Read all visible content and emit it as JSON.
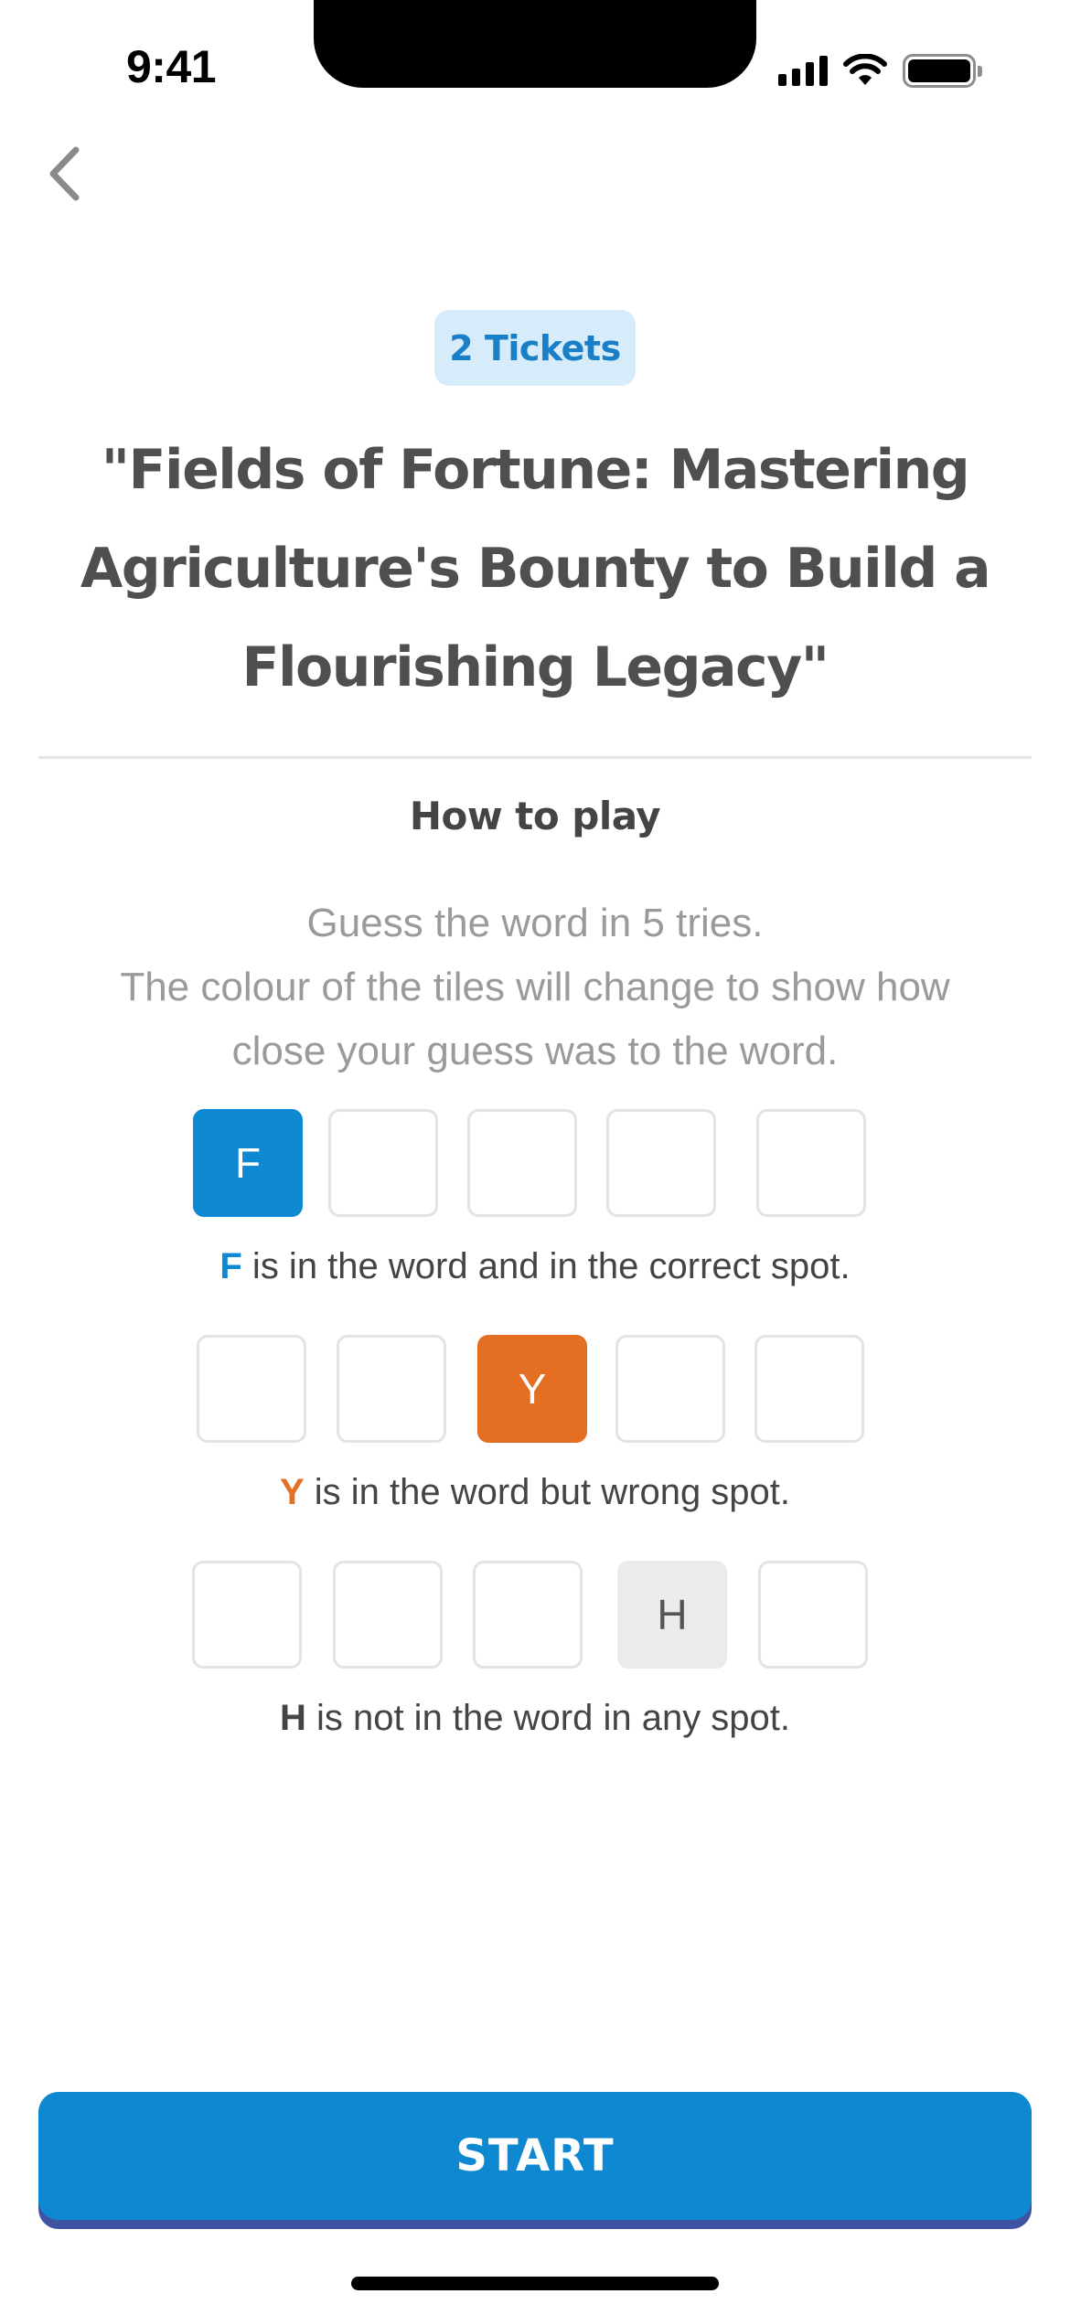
{
  "status_bar": {
    "time": "9:41",
    "icons": [
      "cellular-signal-icon",
      "wifi-icon",
      "battery-icon"
    ]
  },
  "header": {
    "back_icon": "chevron-left-icon",
    "tickets": "2 Tickets",
    "title_lines": [
      "\"Fields of Fortune: Mastering",
      "Agriculture's Bounty to Build a",
      "Flourishing Legacy\""
    ]
  },
  "how_to_play": {
    "heading": "How to play",
    "lines": [
      "Guess the word in 5 tries.",
      "The colour of the tiles will change to show how",
      "close your guess was to the word."
    ],
    "examples": [
      {
        "tiles": [
          "F",
          "",
          "",
          "",
          ""
        ],
        "highlight_index": 0,
        "state": "correct",
        "letter": "F",
        "caption": " is in the word and in the correct spot."
      },
      {
        "tiles": [
          "",
          "",
          "Y",
          "",
          ""
        ],
        "highlight_index": 2,
        "state": "present",
        "letter": "Y",
        "caption": " is in the word but wrong spot."
      },
      {
        "tiles": [
          "",
          "",
          "",
          "H",
          ""
        ],
        "highlight_index": 3,
        "state": "absent",
        "letter": "H",
        "caption": " is not in the word in any spot."
      }
    ]
  },
  "start_button": {
    "label": "START"
  },
  "colors": {
    "correct": "#0f88d2",
    "present": "#e46e22",
    "absent": "#ebebeb",
    "badge_bg": "#d7ecfa",
    "button": "#0f88d2",
    "button_shadow": "#3f53a3"
  }
}
